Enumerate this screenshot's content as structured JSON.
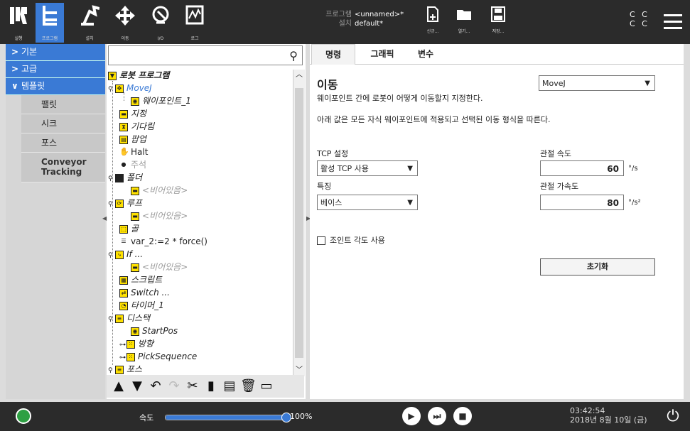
{
  "topbar": {
    "tabs": [
      {
        "label": "실행",
        "icon": "ur-logo-icon"
      },
      {
        "label": "프로그램",
        "icon": "program-icon"
      },
      {
        "label": "설치",
        "icon": "installation-icon"
      },
      {
        "label": "이동",
        "icon": "move-icon"
      },
      {
        "label": "I/O",
        "icon": "io-icon"
      },
      {
        "label": "로그",
        "icon": "log-icon"
      }
    ],
    "program_key": "프로그램",
    "program_value": "<unnamed>*",
    "install_key": "설치",
    "install_value": "default*",
    "file_buttons": [
      {
        "label": "신규...",
        "icon": "new-file-icon"
      },
      {
        "label": "열기...",
        "icon": "open-folder-icon"
      },
      {
        "label": "저장...",
        "icon": "save-icon"
      }
    ],
    "cc_line1": "C C",
    "cc_line2": "C C"
  },
  "leftnav": {
    "basic": "기본",
    "advanced": "고급",
    "templates": "템플릿",
    "template_items": [
      "팰릿",
      "시크",
      "포스",
      "Conveyor Tracking"
    ]
  },
  "search": {
    "placeholder": ""
  },
  "tree": {
    "nodes": [
      {
        "label": "로봇 프로그램"
      },
      {
        "label": "MoveJ"
      },
      {
        "label": "웨이포인트_1"
      },
      {
        "label": "지정"
      },
      {
        "label": "기다림"
      },
      {
        "label": "팝업"
      },
      {
        "label": "Halt"
      },
      {
        "label": "주석"
      },
      {
        "label": "폴더"
      },
      {
        "label": "<비어있음>"
      },
      {
        "label": "루프"
      },
      {
        "label": "<비어있음>"
      },
      {
        "label": "골"
      },
      {
        "label": "var_2:=2 * force()"
      },
      {
        "label": "If ..."
      },
      {
        "label": "<비어있음>"
      },
      {
        "label": "스크립트"
      },
      {
        "label": "Switch ..."
      },
      {
        "label": "타이머_1"
      },
      {
        "label": "디스택"
      },
      {
        "label": "StartPos"
      },
      {
        "label": "방향"
      },
      {
        "label": "PickSequence"
      },
      {
        "label": "포스"
      }
    ]
  },
  "right": {
    "tabs": [
      "명령",
      "그래픽",
      "변수"
    ],
    "title": "이동",
    "desc1": "웨이포인트 간에 로봇이 어떻게 이동할지 지정한다.",
    "desc2": "아래 값은 모든 자식 웨이포인트에 적용되고 선택된 이동 형식을 따른다.",
    "move_type": "MoveJ",
    "tcp_label": "TCP 설정",
    "tcp_value": "활성 TCP 사용",
    "feature_label": "특징",
    "feature_value": "베이스",
    "joint_speed_label": "관절 속도",
    "joint_speed_value": "60",
    "joint_speed_unit": "°/s",
    "joint_accel_label": "관절 가속도",
    "joint_accel_value": "80",
    "joint_accel_unit": "°/s²",
    "use_joint_angles": "조인트 각도 사용",
    "reset_label": "초기화"
  },
  "bottombar": {
    "speed_label": "속도",
    "speed_value": "100%",
    "speed_fraction": 1.0,
    "time": "03:42:54",
    "date": "2018년 8월 10일 (금)"
  },
  "colors": {
    "accent": "#3a7ad5",
    "bar": "#2b2b2b",
    "node_yellow": "#ffe100",
    "status_green": "#2ea043"
  }
}
